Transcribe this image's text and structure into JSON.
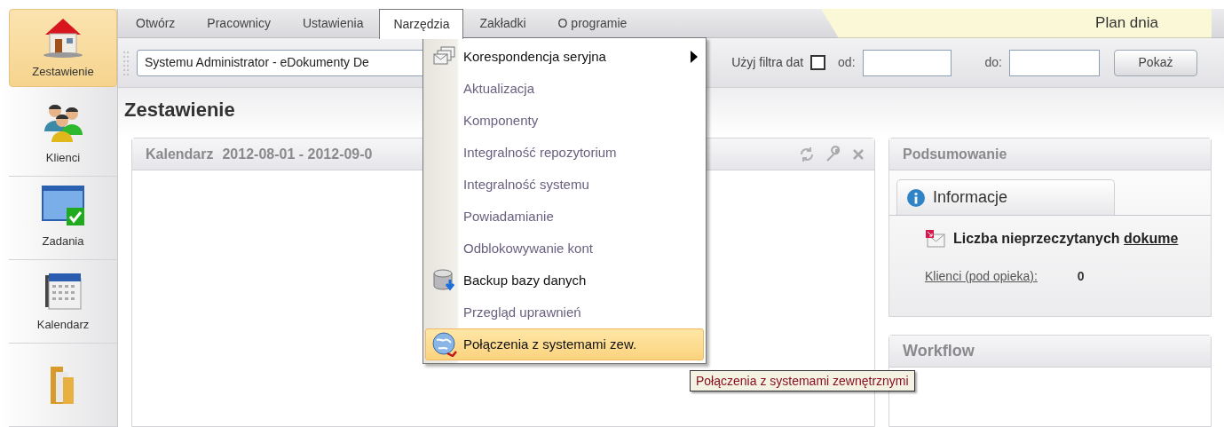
{
  "sidebar": {
    "items": [
      {
        "kind": "house",
        "label": "Zestawienie",
        "selected": true
      },
      {
        "kind": "people",
        "label": "Klienci",
        "selected": false
      },
      {
        "kind": "tasks",
        "label": "Zadania",
        "selected": false
      },
      {
        "kind": "calendar",
        "label": "Kalendarz",
        "selected": false
      },
      {
        "kind": "folder",
        "selected": false
      }
    ]
  },
  "menu_bar": {
    "items": [
      {
        "label": "Otwórz",
        "selected": false
      },
      {
        "label": "Pracownicy",
        "selected": false
      },
      {
        "label": "Ustawienia",
        "selected": false
      },
      {
        "label": "Narzędzia",
        "selected": true
      },
      {
        "label": "Zakładki",
        "selected": false
      },
      {
        "label": "O programie",
        "selected": false
      }
    ]
  },
  "plan_tab": {
    "label": "Plan dnia"
  },
  "toolbar": {
    "user_select": "Systemu Administrator - eDokumenty De",
    "date_filter_label": "Użyj filtra dat",
    "date_filter_checked": false,
    "from_label": "od:",
    "to_label": "do:",
    "show_button": "Pokaż"
  },
  "page_title": "Zestawienie",
  "calendar_panel": {
    "title": "Kalendarz",
    "range": "2012-08-01 - 2012-09-0"
  },
  "summary_panel": {
    "title": "Podsumowanie",
    "tab": "Informacje",
    "unread_text": "Liczba nieprzeczytanych",
    "unread_link": "dokume",
    "clients_label": "Klienci (pod opieka):",
    "clients_value": "0"
  },
  "workflow_panel": {
    "title": "Workflow"
  },
  "dropdown": {
    "items": [
      {
        "label": "Korespondencja seryjna",
        "kind": "envelopes",
        "submenu": true,
        "disabled": false,
        "selected": false
      },
      {
        "label": "Aktualizacja",
        "disabled": true,
        "submenu": false,
        "selected": false
      },
      {
        "label": "Komponenty",
        "disabled": true,
        "submenu": false,
        "selected": false
      },
      {
        "label": "Integralność repozytorium",
        "disabled": true,
        "submenu": false,
        "selected": false
      },
      {
        "label": "Integralność systemu",
        "disabled": true,
        "submenu": false,
        "selected": false
      },
      {
        "label": "Powiadamianie",
        "disabled": true,
        "submenu": false,
        "selected": false
      },
      {
        "label": "Odblokowywanie kont",
        "disabled": true,
        "submenu": false,
        "selected": false
      },
      {
        "label": "Backup bazy danych",
        "kind": "database",
        "disabled": false,
        "submenu": false,
        "selected": false
      },
      {
        "label": "Przegląd uprawnień",
        "disabled": true,
        "submenu": false,
        "selected": false
      },
      {
        "label": "Połączenia z systemami zew.",
        "kind": "globe",
        "disabled": false,
        "submenu": false,
        "selected": true
      }
    ]
  },
  "tooltip": "Połączenia z systemami zewnętrznymi"
}
